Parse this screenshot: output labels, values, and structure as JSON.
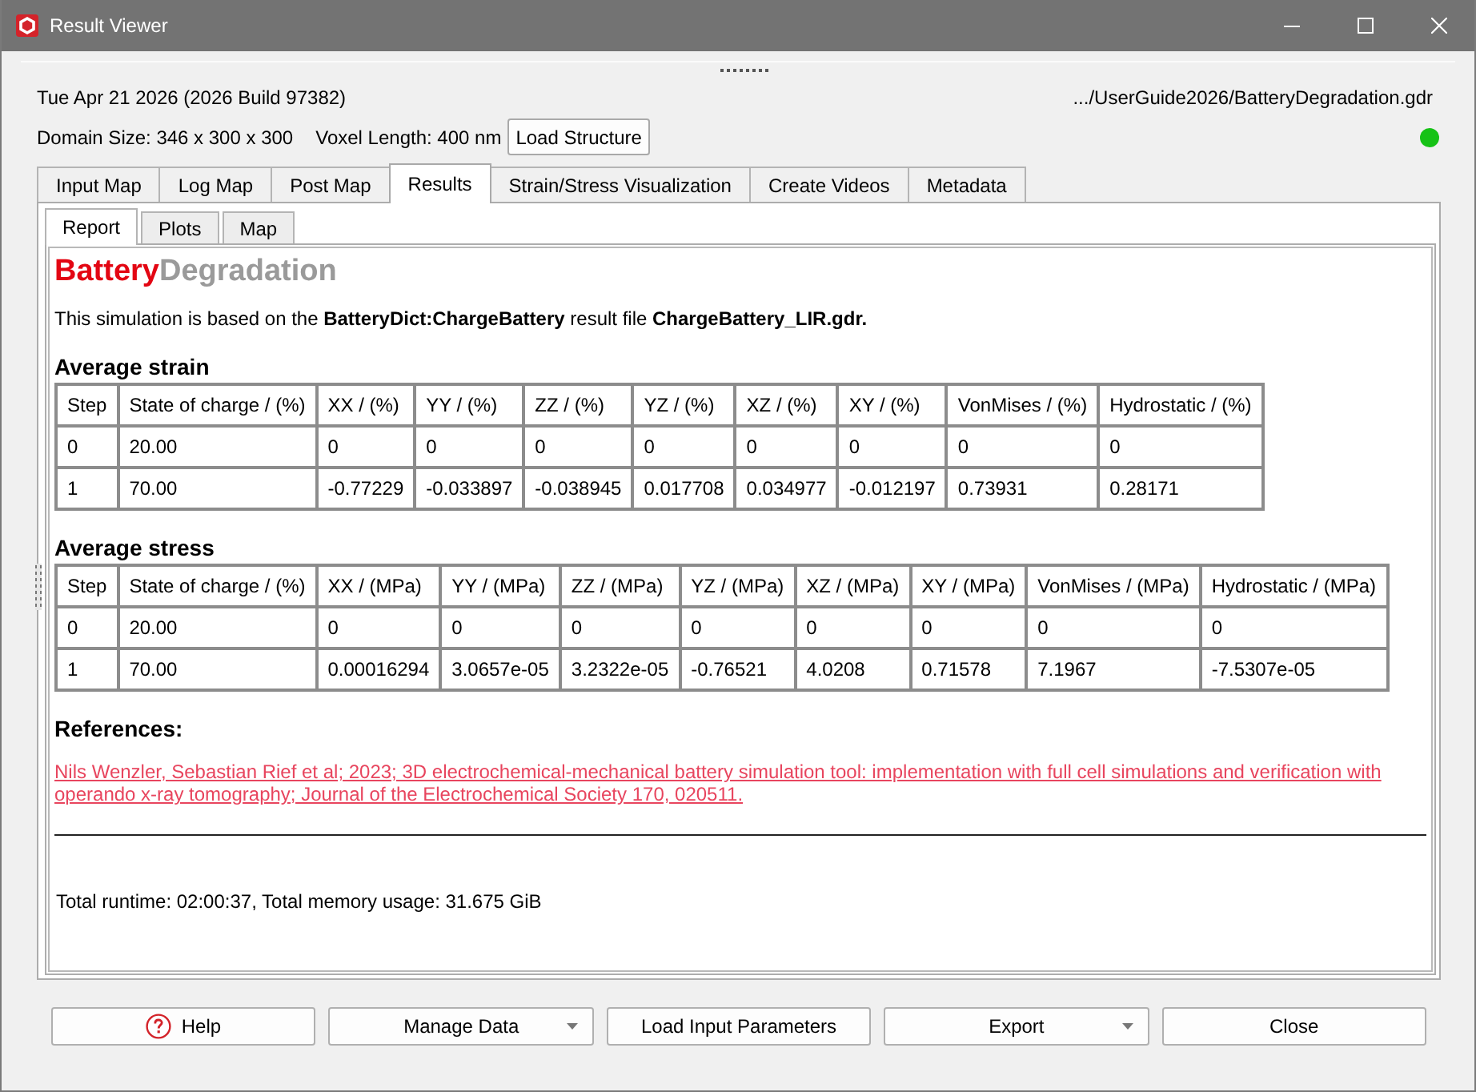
{
  "window": {
    "title": "Result Viewer"
  },
  "header": {
    "build": "Tue Apr 21 2026 (2026 Build 97382)",
    "file_path": ".../UserGuide2026/BatteryDegradation.gdr",
    "domain_size": "Domain Size: 346 x 300 x 300",
    "voxel_length": "Voxel Length: 400 nm",
    "load_button": "Load Structure"
  },
  "tabs": [
    {
      "label": "Input Map",
      "selected": false
    },
    {
      "label": "Log Map",
      "selected": false
    },
    {
      "label": "Post Map",
      "selected": false
    },
    {
      "label": "Results",
      "selected": true
    },
    {
      "label": "Strain/Stress Visualization",
      "selected": false
    },
    {
      "label": "Create Videos",
      "selected": false
    },
    {
      "label": "Metadata",
      "selected": false
    }
  ],
  "subtabs": [
    {
      "label": "Report",
      "selected": true
    },
    {
      "label": "Plots",
      "selected": false
    },
    {
      "label": "Map",
      "selected": false
    }
  ],
  "report": {
    "title": [
      {
        "text": "Battery",
        "color": "#e30613"
      },
      {
        "text": "Degradation",
        "color": "#9a9a9a"
      }
    ],
    "intro": "This simulation is based on the **BatteryDict:ChargeBattery** result file **ChargeBattery_LIR.gdr.**",
    "tables": [
      {
        "heading": "Average strain",
        "columns": [
          "Step",
          "State of charge / (%)",
          "XX / (%)",
          "YY / (%)",
          "ZZ / (%)",
          "YZ / (%)",
          "XZ / (%)",
          "XY / (%)",
          "VonMises / (%)",
          "Hydrostatic / (%)"
        ],
        "rows": [
          [
            "0",
            "20.00",
            "0",
            "0",
            "0",
            "0",
            "0",
            "0",
            "0",
            "0"
          ],
          [
            "1",
            "70.00",
            "-0.77229",
            "-0.033897",
            "-0.038945",
            "0.017708",
            "0.034977",
            "-0.012197",
            "0.73931",
            "0.28171"
          ]
        ]
      },
      {
        "heading": "Average stress",
        "columns": [
          "Step",
          "State of charge / (%)",
          "XX / (MPa)",
          "YY / (MPa)",
          "ZZ / (MPa)",
          "YZ / (MPa)",
          "XZ / (MPa)",
          "XY / (MPa)",
          "VonMises / (MPa)",
          "Hydrostatic / (MPa)"
        ],
        "rows": [
          [
            "0",
            "20.00",
            "0",
            "0",
            "0",
            "0",
            "0",
            "0",
            "0",
            "0"
          ],
          [
            "1",
            "70.00",
            "0.00016294",
            "3.0657e-05",
            "3.2322e-05",
            "-0.76521",
            "4.0208",
            "0.71578",
            "7.1967",
            "-7.5307e-05"
          ]
        ]
      }
    ],
    "references_heading": "References:",
    "reference_link": "Nils Wenzler, Sebastian Rief et al; 2023; 3D electrochemical-mechanical battery simulation tool: implementation with full cell simulations and verification with operando x-ray tomography; Journal of the Electrochemical Society 170, 020511.",
    "summary": "Total runtime: 02:00:37, Total memory usage: 31.675 GiB"
  },
  "buttons": [
    {
      "label": "Help",
      "kind": "help"
    },
    {
      "label": "Manage Data",
      "kind": "dropdown"
    },
    {
      "label": "Load Input Parameters",
      "kind": "plain"
    },
    {
      "label": "Export",
      "kind": "dropdown"
    },
    {
      "label": "Close",
      "kind": "plain"
    }
  ]
}
